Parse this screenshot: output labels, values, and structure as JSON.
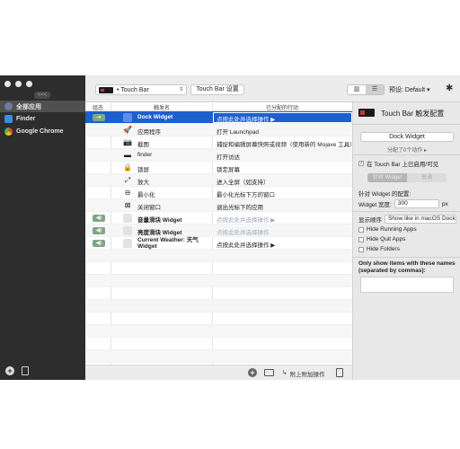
{
  "sidebar": {
    "collapse_label": "<<<",
    "items": [
      {
        "label": "全部应用",
        "color": "#6c7aa0"
      },
      {
        "label": "Finder",
        "color": "#3b8de0"
      },
      {
        "label": "Google Chrome",
        "color": "#d9473a"
      }
    ]
  },
  "toolbar": {
    "touchbar_select": "• Touch Bar",
    "settings_button": "Touch Bar 设置",
    "view_modes": [
      "▥",
      "☰"
    ],
    "preset_label": "预设: Default",
    "preset_arrow": "▾",
    "gear": "✱"
  },
  "table": {
    "headers": {
      "group": "组态",
      "trigger": "触发名",
      "action": "已分配的行动"
    },
    "rows": [
      {
        "group": "⇥",
        "icon": "",
        "name": "Dock Widget",
        "action": "点按此处并选择操作 ▶",
        "selected": true,
        "bold": true
      },
      {
        "group": "",
        "icon": "🚀",
        "name": "应用程序",
        "action": "打开 Launchpad"
      },
      {
        "group": "",
        "icon": "📷",
        "name": "截图",
        "action": "捕捉和编辑屏幕快照或视频（使用新的 Mojave 工具）"
      },
      {
        "group": "",
        "icon": "▬",
        "name": "finder",
        "action": "打开访达"
      },
      {
        "group": "",
        "icon": "🔒",
        "name": "锁屏",
        "action": "锁定屏幕"
      },
      {
        "group": "",
        "icon": "⤢",
        "name": "放大",
        "action": "进入全屏（如支持）"
      },
      {
        "group": "",
        "icon": "⊖",
        "name": "最小化",
        "action": "最小化光标下方的窗口"
      },
      {
        "group": "",
        "icon": "⊠",
        "name": "关闭窗口",
        "action": "退出光标下的应用"
      },
      {
        "group": "◀)",
        "icon": "",
        "name": "音量滑块 Widget",
        "action": "点按此处并选择操作 ▶",
        "bold": true,
        "blur": true
      },
      {
        "group": "◀)",
        "icon": "",
        "name": "亮度滑块 Widget",
        "action": "点按此处并选择操作",
        "bold": true,
        "blur": true
      },
      {
        "group": "◀)",
        "icon": "",
        "name": "Current Weather: 天气 Widget",
        "action": "点按此处并选择操作 ▶",
        "bold": true,
        "two_line": true
      }
    ]
  },
  "footer": {
    "add": "+",
    "append_label": "附上附加操作"
  },
  "panel": {
    "title": "Touch Bar 触发配置",
    "select_value": "Dock Widget",
    "assigned": "分配了0个动作 ▸",
    "enabled_label": "在 Touch Bar 上已启用/可见",
    "seg": [
      "针对 Widget",
      "普通"
    ],
    "widget_config": "针对 Widget 的配置:",
    "width_label": "Widget 宽度:",
    "width_value": "300",
    "width_unit": "px",
    "order_label": "显示顺序",
    "order_value": "Show like in macOS Dock",
    "options": [
      "Hide Running Apps",
      "Hide Quit Apps",
      "Hide Folders"
    ],
    "names_label": "Only show items with these names (separated by commas):"
  }
}
